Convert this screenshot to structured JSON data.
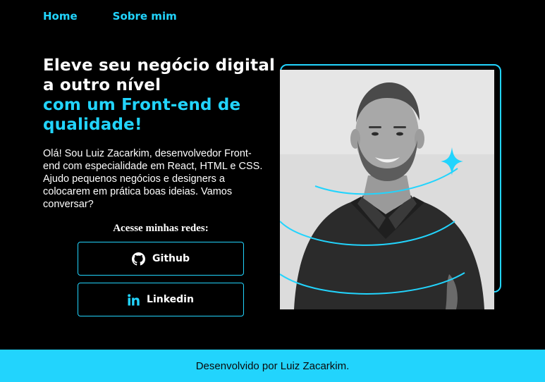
{
  "nav": {
    "home": "Home",
    "about": "Sobre mim"
  },
  "hero": {
    "title_white": "Eleve seu negócio digital a outro nível",
    "title_accent": "com um Front-end de qualidade!",
    "intro": "Olá! Sou Luiz Zacarkim, desenvolvedor Front-end com especialidade em React, HTML e CSS. Ajudo pequenos negócios e designers a colocarem em prática boas ideias. Vamos conversar?"
  },
  "socials": {
    "title": "Acesse minhas redes:",
    "github": {
      "label": "Github",
      "icon": "github-icon"
    },
    "linkedin": {
      "label": "Linkedin",
      "icon": "linkedin-icon"
    }
  },
  "photo": {
    "icon": "portrait-photo"
  },
  "footer": {
    "text": "Desenvolvido por Luiz Zacarkim."
  },
  "colors": {
    "accent": "#22d4fd",
    "background": "#000000",
    "footer_text": "#0a0a0a"
  }
}
